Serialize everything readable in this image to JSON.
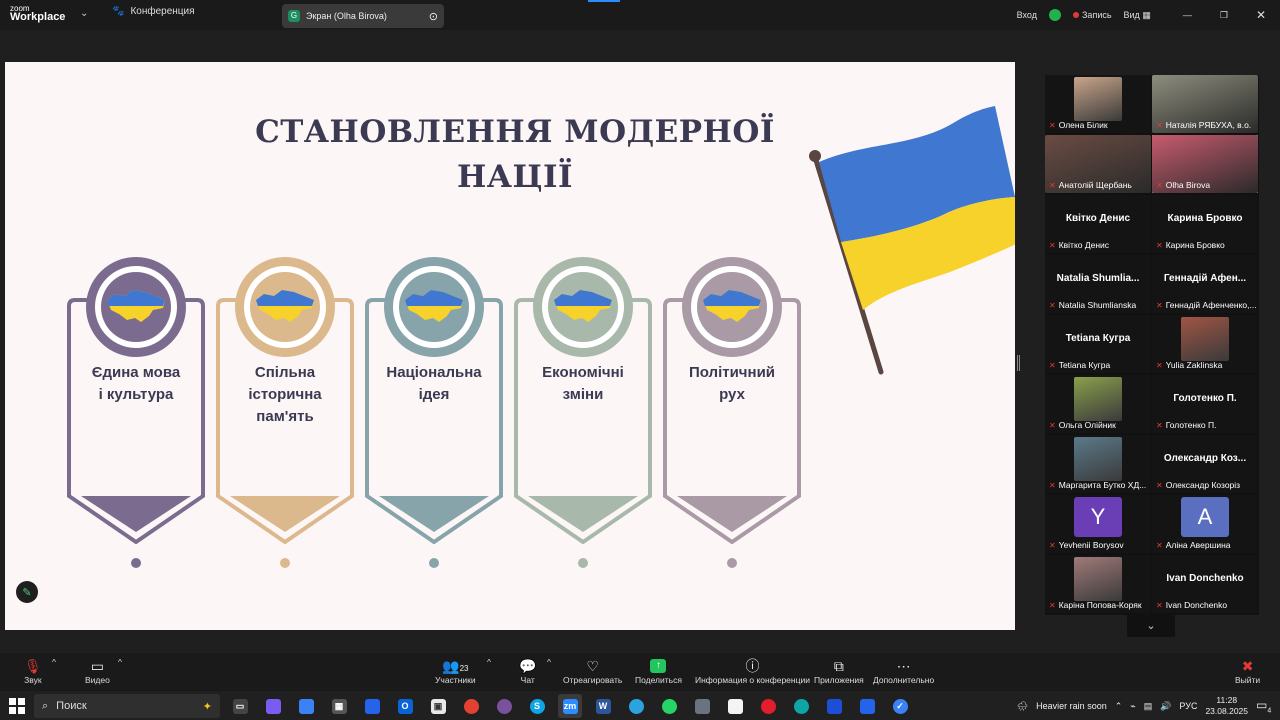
{
  "app": {
    "logo_line1": "zoom",
    "logo_line2": "Workplace"
  },
  "tabs": {
    "meeting_label": "Конференция",
    "screen_label": "Экран (Olha Birova)"
  },
  "top_right": {
    "enter": "Вход",
    "record": "Запись",
    "view": "Вид"
  },
  "slide": {
    "title_line1": "СТАНОВЛЕННЯ МОДЕРНОЇ",
    "title_line2": "НАЦІЇ",
    "cards": [
      {
        "label": "Єдина мова\nі культура",
        "color": "#7b6c8f"
      },
      {
        "label": "Спільна\nісторична\nпам'ять",
        "color": "#dcb98d"
      },
      {
        "label": "Національна\nідея",
        "color": "#87a4ab"
      },
      {
        "label": "Економічні\nзміни",
        "color": "#a8b8aa"
      },
      {
        "label": "Політичний\nрух",
        "color": "#a99aa6"
      }
    ],
    "flag_colors": {
      "blue": "#3f77d1",
      "yellow": "#f6d22a",
      "pole": "#5a4640"
    }
  },
  "participants": [
    {
      "name": "Олена Білик",
      "type": "video",
      "tint": "#c9a58a"
    },
    {
      "name": "Наталія РЯБУХА, в.о.",
      "type": "video",
      "tint": "#8d8d7d"
    },
    {
      "name": "Анатолій Щербань",
      "type": "video",
      "tint": "#6b4c43"
    },
    {
      "name": "Olha Birova",
      "type": "video",
      "tint": "#c85b6e",
      "active": true
    },
    {
      "name": "Квітко Денис",
      "display": "Квітко Денис",
      "type": "name"
    },
    {
      "name": "Карина Бровко",
      "display": "Карина Бровко",
      "type": "name"
    },
    {
      "name": "Natalia Shumlianska",
      "display": "Natalia  Shumlia...",
      "type": "name"
    },
    {
      "name": "Геннадій Афенченко,...",
      "display": "Геннадій Афен...",
      "type": "name"
    },
    {
      "name": "Tetiana Кугра",
      "display": "Tetiana Кугра",
      "type": "name"
    },
    {
      "name": "Yulia Zaklinska",
      "type": "video",
      "tint": "#a05545"
    },
    {
      "name": "Ольга Олійник",
      "type": "video",
      "tint": "#8aa04c"
    },
    {
      "name": "Голотенко П.",
      "display": "Голотенко П.",
      "type": "name"
    },
    {
      "name": "Маргарита Бутко ХД...",
      "type": "video",
      "tint": "#5b7a8a"
    },
    {
      "name": "Олександр Козоріз",
      "display": "Олександр  Коз...",
      "type": "name"
    },
    {
      "name": "Yevhenii Borysov",
      "type": "letter",
      "letter": "Y",
      "tint": "#6a3fb5"
    },
    {
      "name": "Аліна Авершина",
      "type": "letter",
      "letter": "A",
      "tint": "#5a6fc0"
    },
    {
      "name": "Каріна Попова-Коряк",
      "type": "video",
      "tint": "#a07a78"
    },
    {
      "name": "Ivan Donchenko",
      "display": "Ivan Donchenko",
      "type": "name"
    }
  ],
  "toolbar": {
    "audio": "Звук",
    "video": "Видео",
    "participants": "Участники",
    "participants_count": "23",
    "chat": "Чат",
    "react": "Отреагировать",
    "share": "Поделиться",
    "info": "Информация о конференции",
    "apps": "Приложения",
    "more": "Дополнительно",
    "leave": "Выйти"
  },
  "taskbar": {
    "search": "Поиск",
    "weather": "Heavier rain soon",
    "lang": "РУС",
    "time": "11:28",
    "date": "23.08.2025",
    "notifications": "4"
  }
}
